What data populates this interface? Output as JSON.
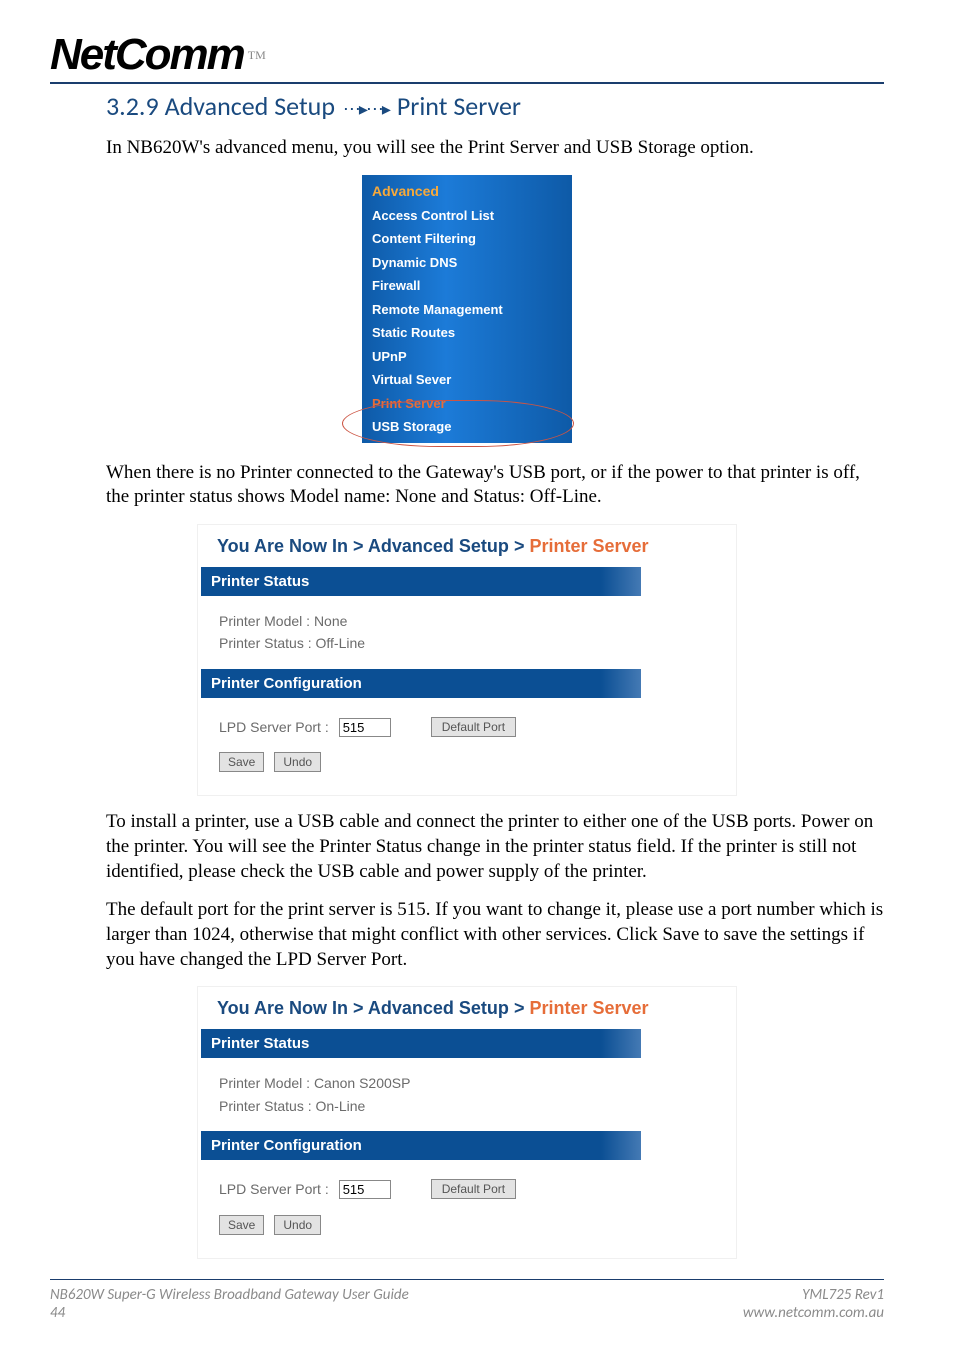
{
  "header": {
    "logo_text": "NetComm",
    "tm": "TM"
  },
  "section": {
    "number": "3.2.9",
    "title_a": "Advanced Setup",
    "title_b": "Print Server"
  },
  "paragraphs": {
    "p1": "In NB620W's advanced menu, you will see the Print Server and USB Storage option.",
    "p2": "When there is no Printer connected to the Gateway's USB port, or if the power to that printer is off, the printer status shows Model name: None and Status: Off-Line.",
    "p3": "To install a printer, use a USB cable and connect the printer to either one of the USB ports.  Power on the printer.  You will see the Printer Status change in the printer status field.  If the printer is still not identified, please check the USB cable and power supply of the printer.",
    "p4": "The default port for the print server is 515.  If you want to change it, please use a port number which is larger than 1024, otherwise that might conflict with other services. Click Save to save the settings if you have changed the LPD Server Port."
  },
  "menu": {
    "head": "Advanced",
    "items": [
      "Access Control List",
      "Content Filtering",
      "Dynamic DNS",
      "Firewall",
      "Remote Management",
      "Static Routes",
      "UPnP",
      "Virtual Sever"
    ],
    "highlight": "Print  Server",
    "last": "USB Storage"
  },
  "breadcrumb": {
    "a": "You Are Now In",
    "b": "Advanced Setup",
    "c": "Printer Server",
    "sep": ">"
  },
  "panel1": {
    "bar1": "Printer Status",
    "model_label": "Printer Model :",
    "model_value": "None",
    "status_label": "Printer Status :",
    "status_value": "Off-Line",
    "bar2": "Printer Configuration",
    "port_label": "LPD Server Port :",
    "port_value": "515",
    "default_btn": "Default Port",
    "save_btn": "Save",
    "undo_btn": "Undo"
  },
  "panel2": {
    "bar1": "Printer Status",
    "model_label": "Printer Model :",
    "model_value": "Canon S200SP",
    "status_label": "Printer Status :",
    "status_value": "On-Line",
    "bar2": "Printer Configuration",
    "port_label": "LPD Server Port :",
    "port_value": "515",
    "default_btn": "Default Port",
    "save_btn": "Save",
    "undo_btn": "Undo"
  },
  "footer": {
    "left_line1": "NB620W Super-G Wireless Broadband  Gateway User Guide",
    "left_line2": "44",
    "right_line1": "YML725 Rev1",
    "right_line2": "www.netcomm.com.au"
  }
}
